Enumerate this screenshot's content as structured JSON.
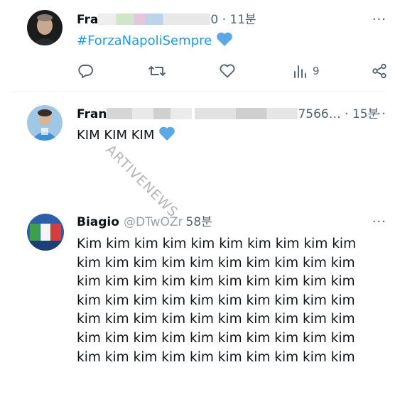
{
  "tweets": [
    {
      "name_visible": "Fra",
      "time_visible": "0 · 11분",
      "text_prefix": "#ForzaNapoliSempre",
      "emoji": "blue-heart",
      "actions": {
        "views": "9"
      }
    },
    {
      "name_visible": "Fran",
      "handle_visible": "7566…",
      "time_visible": " · 15분",
      "text": "KIM KIM KIM",
      "emoji": "blue-heart"
    },
    {
      "name_visible": "Biagio",
      "handle_visible": "@DTwOZr",
      "time_visible": "58분",
      "text": "Kim kim kim kim kim kim kim kim kim kim\nkim kim kim kim kim kim kim kim kim kim\nkim kim kim kim kim kim kim kim kim kim\nkim kim kim kim kim kim kim kim kim kim\nkim kim kim kim kim kim kim kim kim kim\nkim kim kim kim kim kim kim kim kim kim\nkim kim kim kim kim kim kim kim kim kim"
    }
  ],
  "more_label": "···",
  "watermark": "ARTIVENEWS",
  "colors": {
    "text": "#0f1419",
    "secondary": "#536471",
    "accent": "#1d9bf0",
    "heart": "#5aa9e6",
    "divider": "#eff3f4"
  }
}
